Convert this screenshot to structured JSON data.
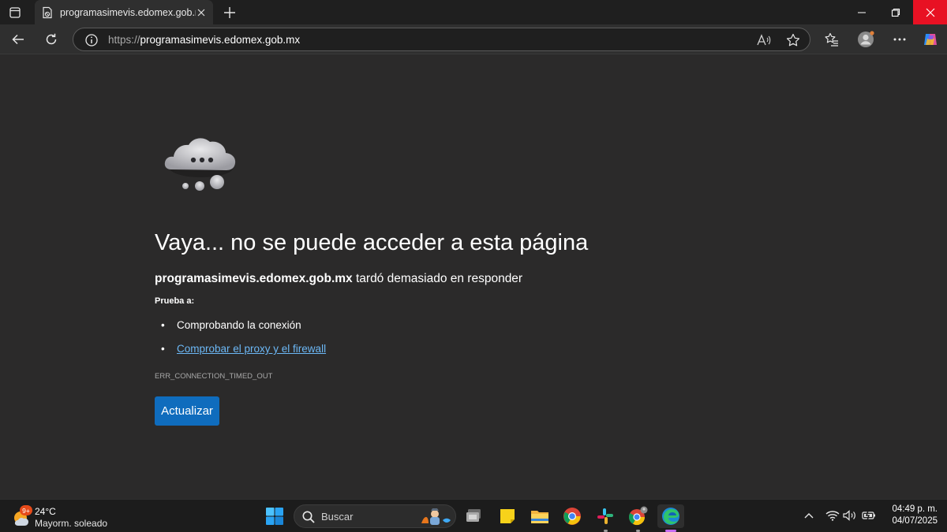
{
  "browser": {
    "tab_title": "programasimevis.edomex.gob.mx",
    "url_scheme": "https://",
    "url_host": "programasimevis.edomex.gob.mx"
  },
  "error_page": {
    "heading": "Vaya... no se puede acceder a esta página",
    "host": "programasimevis.edomex.gob.mx",
    "message": " tardó demasiado en responder",
    "try_label": "Prueba a:",
    "suggestions": [
      "Comprobando la conexión",
      "Comprobar el proxy y el firewall"
    ],
    "error_code": "ERR_CONNECTION_TIMED_OUT",
    "refresh_label": "Actualizar"
  },
  "taskbar": {
    "weather_badge": "9+",
    "temperature": "24°C",
    "condition": "Mayorm. soleado",
    "search_placeholder": "Buscar",
    "time": "04:49 p. m.",
    "date": "04/07/2025"
  },
  "colors": {
    "accent": "#0f6cbd",
    "link": "#6cb8f6",
    "close_button": "#e81123"
  },
  "icons": {
    "tab_favicon": "page-icon",
    "info": "info-icon",
    "read_aloud": "read-aloud-icon",
    "favorite": "star-icon",
    "collections": "favorites-list-icon",
    "profile": "profile-icon",
    "more": "more-icon",
    "copilot": "copilot-icon"
  }
}
